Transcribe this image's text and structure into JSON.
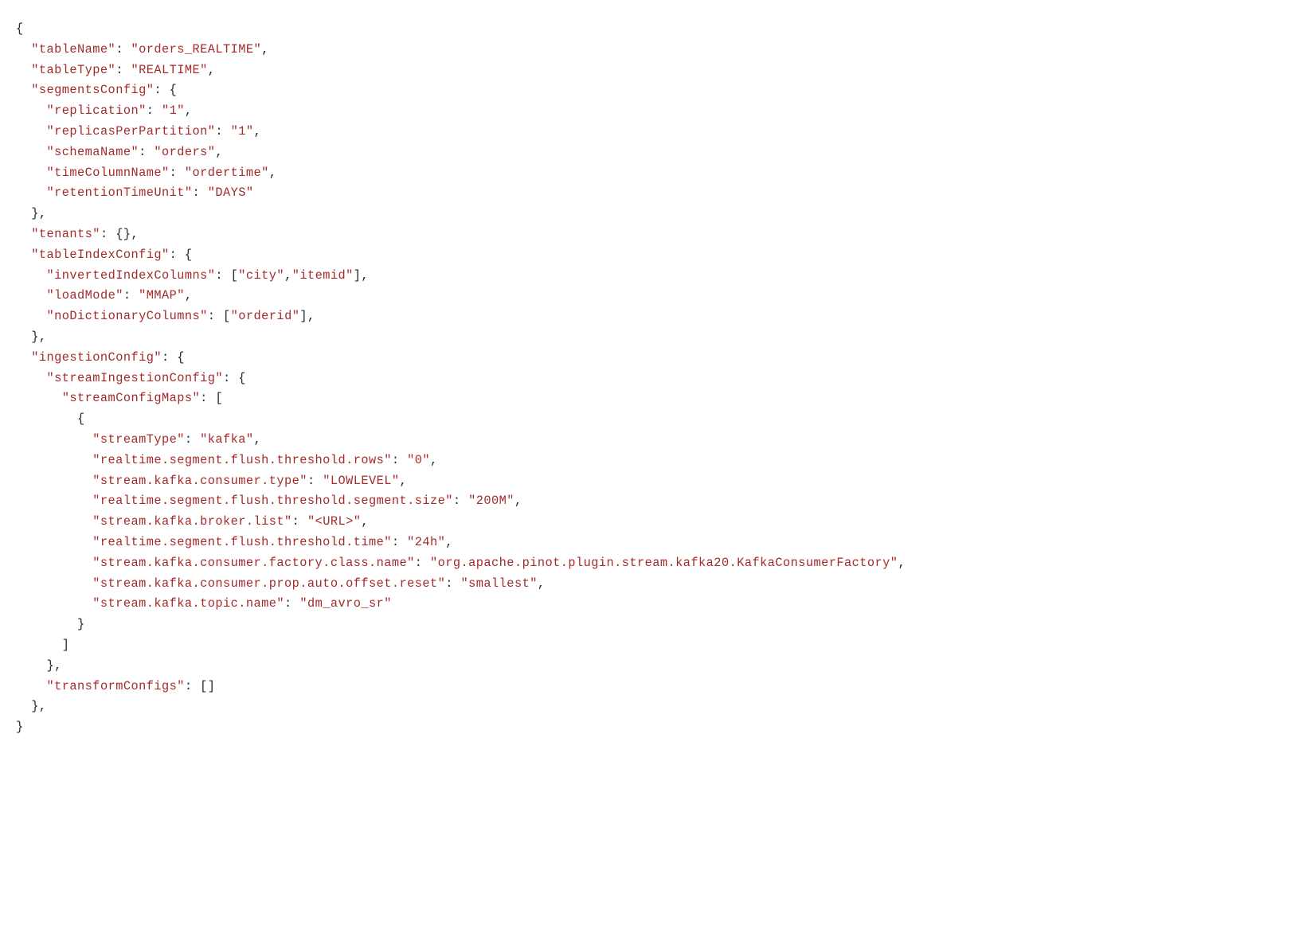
{
  "lines": [
    [
      {
        "c": "p",
        "t": "{"
      }
    ],
    [
      {
        "c": "p",
        "t": "  "
      },
      {
        "c": "s",
        "t": "\"tableName\""
      },
      {
        "c": "p",
        "t": ": "
      },
      {
        "c": "s",
        "t": "\"orders_REALTIME\""
      },
      {
        "c": "p",
        "t": ","
      }
    ],
    [
      {
        "c": "p",
        "t": "  "
      },
      {
        "c": "s",
        "t": "\"tableType\""
      },
      {
        "c": "p",
        "t": ": "
      },
      {
        "c": "s",
        "t": "\"REALTIME\""
      },
      {
        "c": "p",
        "t": ","
      }
    ],
    [
      {
        "c": "p",
        "t": "  "
      },
      {
        "c": "s",
        "t": "\"segmentsConfig\""
      },
      {
        "c": "p",
        "t": ": {"
      }
    ],
    [
      {
        "c": "p",
        "t": "    "
      },
      {
        "c": "s",
        "t": "\"replication\""
      },
      {
        "c": "p",
        "t": ": "
      },
      {
        "c": "s",
        "t": "\"1\""
      },
      {
        "c": "p",
        "t": ","
      }
    ],
    [
      {
        "c": "p",
        "t": "    "
      },
      {
        "c": "s",
        "t": "\"replicasPerPartition\""
      },
      {
        "c": "p",
        "t": ": "
      },
      {
        "c": "s",
        "t": "\"1\""
      },
      {
        "c": "p",
        "t": ","
      }
    ],
    [
      {
        "c": "p",
        "t": "    "
      },
      {
        "c": "s",
        "t": "\"schemaName\""
      },
      {
        "c": "p",
        "t": ": "
      },
      {
        "c": "s",
        "t": "\"orders\""
      },
      {
        "c": "p",
        "t": ","
      }
    ],
    [
      {
        "c": "p",
        "t": "    "
      },
      {
        "c": "s",
        "t": "\"timeColumnName\""
      },
      {
        "c": "p",
        "t": ": "
      },
      {
        "c": "s",
        "t": "\"ordertime\""
      },
      {
        "c": "p",
        "t": ","
      }
    ],
    [
      {
        "c": "p",
        "t": "    "
      },
      {
        "c": "s",
        "t": "\"retentionTimeUnit\""
      },
      {
        "c": "p",
        "t": ": "
      },
      {
        "c": "s",
        "t": "\"DAYS\""
      }
    ],
    [
      {
        "c": "p",
        "t": "  },"
      }
    ],
    [
      {
        "c": "p",
        "t": "  "
      },
      {
        "c": "s",
        "t": "\"tenants\""
      },
      {
        "c": "p",
        "t": ": {},"
      }
    ],
    [
      {
        "c": "p",
        "t": "  "
      },
      {
        "c": "s",
        "t": "\"tableIndexConfig\""
      },
      {
        "c": "p",
        "t": ": {"
      }
    ],
    [
      {
        "c": "p",
        "t": "    "
      },
      {
        "c": "s",
        "t": "\"invertedIndexColumns\""
      },
      {
        "c": "p",
        "t": ": ["
      },
      {
        "c": "s",
        "t": "\"city\""
      },
      {
        "c": "p",
        "t": ","
      },
      {
        "c": "s",
        "t": "\"itemid\""
      },
      {
        "c": "p",
        "t": "],"
      }
    ],
    [
      {
        "c": "p",
        "t": "    "
      },
      {
        "c": "s",
        "t": "\"loadMode\""
      },
      {
        "c": "p",
        "t": ": "
      },
      {
        "c": "s",
        "t": "\"MMAP\""
      },
      {
        "c": "p",
        "t": ","
      }
    ],
    [
      {
        "c": "p",
        "t": "    "
      },
      {
        "c": "s",
        "t": "\"noDictionaryColumns\""
      },
      {
        "c": "p",
        "t": ": ["
      },
      {
        "c": "s",
        "t": "\"orderid\""
      },
      {
        "c": "p",
        "t": "],"
      }
    ],
    [
      {
        "c": "p",
        "t": "  },"
      }
    ],
    [
      {
        "c": "p",
        "t": "  "
      },
      {
        "c": "s",
        "t": "\"ingestionConfig\""
      },
      {
        "c": "p",
        "t": ": {"
      }
    ],
    [
      {
        "c": "p",
        "t": "    "
      },
      {
        "c": "s",
        "t": "\"streamIngestionConfig\""
      },
      {
        "c": "p",
        "t": ": {"
      }
    ],
    [
      {
        "c": "p",
        "t": "      "
      },
      {
        "c": "s",
        "t": "\"streamConfigMaps\""
      },
      {
        "c": "p",
        "t": ": ["
      }
    ],
    [
      {
        "c": "p",
        "t": "        {"
      }
    ],
    [
      {
        "c": "p",
        "t": "          "
      },
      {
        "c": "s",
        "t": "\"streamType\""
      },
      {
        "c": "p",
        "t": ": "
      },
      {
        "c": "s",
        "t": "\"kafka\""
      },
      {
        "c": "p",
        "t": ","
      }
    ],
    [
      {
        "c": "p",
        "t": "          "
      },
      {
        "c": "s",
        "t": "\"realtime.segment.flush.threshold.rows\""
      },
      {
        "c": "p",
        "t": ": "
      },
      {
        "c": "s",
        "t": "\"0\""
      },
      {
        "c": "p",
        "t": ","
      }
    ],
    [
      {
        "c": "p",
        "t": "          "
      },
      {
        "c": "s",
        "t": "\"stream.kafka.consumer.type\""
      },
      {
        "c": "p",
        "t": ": "
      },
      {
        "c": "s",
        "t": "\"LOWLEVEL\""
      },
      {
        "c": "p",
        "t": ","
      }
    ],
    [
      {
        "c": "p",
        "t": "          "
      },
      {
        "c": "s",
        "t": "\"realtime.segment.flush.threshold.segment.size\""
      },
      {
        "c": "p",
        "t": ": "
      },
      {
        "c": "s",
        "t": "\"200M\""
      },
      {
        "c": "p",
        "t": ","
      }
    ],
    [
      {
        "c": "p",
        "t": "          "
      },
      {
        "c": "s",
        "t": "\"stream.kafka.broker.list\""
      },
      {
        "c": "p",
        "t": ": "
      },
      {
        "c": "s",
        "t": "\"<URL>\""
      },
      {
        "c": "p",
        "t": ","
      }
    ],
    [
      {
        "c": "p",
        "t": "          "
      },
      {
        "c": "s",
        "t": "\"realtime.segment.flush.threshold.time\""
      },
      {
        "c": "p",
        "t": ": "
      },
      {
        "c": "s",
        "t": "\"24h\""
      },
      {
        "c": "p",
        "t": ","
      }
    ],
    [
      {
        "c": "p",
        "t": "          "
      },
      {
        "c": "s",
        "t": "\"stream.kafka.consumer.factory.class.name\""
      },
      {
        "c": "p",
        "t": ": "
      },
      {
        "c": "s",
        "t": "\"org.apache.pinot.plugin.stream.kafka20.KafkaConsumerFactory\""
      },
      {
        "c": "p",
        "t": ","
      }
    ],
    [
      {
        "c": "p",
        "t": "          "
      },
      {
        "c": "s",
        "t": "\"stream.kafka.consumer.prop.auto.offset.reset\""
      },
      {
        "c": "p",
        "t": ": "
      },
      {
        "c": "s",
        "t": "\"smallest\""
      },
      {
        "c": "p",
        "t": ","
      }
    ],
    [
      {
        "c": "p",
        "t": "          "
      },
      {
        "c": "s",
        "t": "\"stream.kafka.topic.name\""
      },
      {
        "c": "p",
        "t": ": "
      },
      {
        "c": "s",
        "t": "\"dm_avro_sr\""
      }
    ],
    [
      {
        "c": "p",
        "t": "        }"
      }
    ],
    [
      {
        "c": "p",
        "t": "      ]"
      }
    ],
    [
      {
        "c": "p",
        "t": "    },"
      }
    ],
    [
      {
        "c": "p",
        "t": "    "
      },
      {
        "c": "s",
        "t": "\"transformConfigs\""
      },
      {
        "c": "p",
        "t": ": []"
      }
    ],
    [
      {
        "c": "p",
        "t": "  },"
      }
    ],
    [
      {
        "c": "p",
        "t": "}"
      }
    ]
  ]
}
